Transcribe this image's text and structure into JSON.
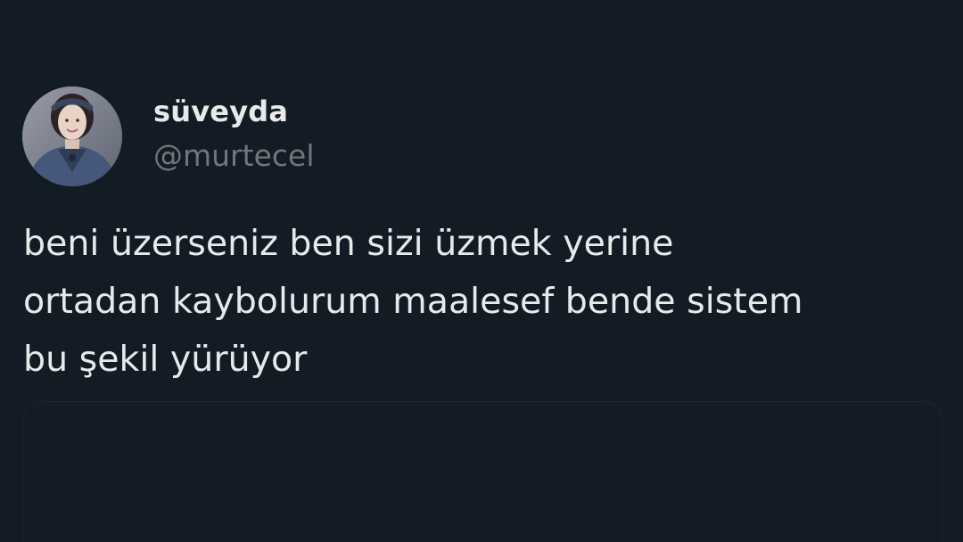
{
  "author": {
    "display_name": "süveyda",
    "handle": "@murtecel",
    "avatar_icon": "profile-photo-avatar"
  },
  "post": {
    "text_lines": [
      "beni üzerseniz ben sizi üzmek yerine",
      "ortadan kaybolurum maalesef bende sistem",
      "bu şekil yürüyor"
    ]
  },
  "colors": {
    "background": "#131b25",
    "primary_text": "#e7e9ea",
    "secondary_text": "#71767b"
  }
}
